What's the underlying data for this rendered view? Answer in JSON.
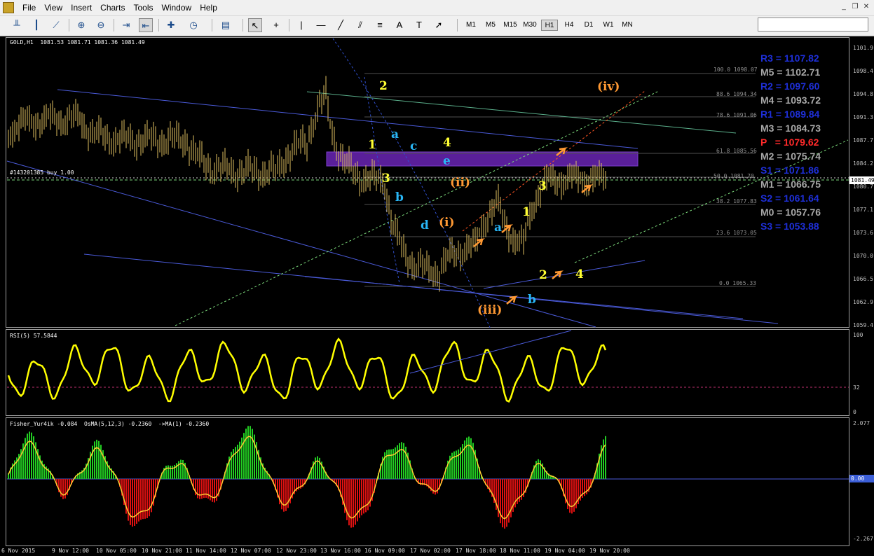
{
  "menu": {
    "items": [
      "File",
      "View",
      "Insert",
      "Charts",
      "Tools",
      "Window",
      "Help"
    ]
  },
  "toolbar": {
    "timeframes": [
      "M1",
      "M5",
      "M15",
      "M30",
      "H1",
      "H4",
      "D1",
      "W1",
      "MN"
    ],
    "active_timeframe": "H1"
  },
  "chart": {
    "title": "GOLD,H1  1081.53 1081.71 1081.36 1081.49",
    "order_label": "#143201385 buy 1.00",
    "current_price": "1081.49",
    "price_scale": [
      "1101.9",
      "1098.4",
      "1094.8",
      "1091.3",
      "1087.7",
      "1084.2",
      "1080.7",
      "1077.1",
      "1073.6",
      "1070.0",
      "1066.5",
      "1062.9",
      "1059.4"
    ],
    "pivots": [
      {
        "label": "R3 = 1107.82",
        "color": "#1e2fd8"
      },
      {
        "label": "M5 = 1102.71",
        "color": "#a8a8a8"
      },
      {
        "label": "R2 = 1097.60",
        "color": "#1e2fd8"
      },
      {
        "label": "M4 = 1093.72",
        "color": "#a8a8a8"
      },
      {
        "label": "R1 = 1089.84",
        "color": "#1e2fd8"
      },
      {
        "label": "M3 = 1084.73",
        "color": "#a8a8a8"
      },
      {
        "label": "P   = 1079.62",
        "color": "#ff2a2a"
      },
      {
        "label": "M2 = 1075.74",
        "color": "#a8a8a8"
      },
      {
        "label": "S1 = 1071.86",
        "color": "#1e2fd8"
      },
      {
        "label": "M1 = 1066.75",
        "color": "#a8a8a8"
      },
      {
        "label": "S2 = 1061.64",
        "color": "#1e2fd8"
      },
      {
        "label": "M0 = 1057.76",
        "color": "#a8a8a8"
      },
      {
        "label": "S3 = 1053.88",
        "color": "#1e2fd8"
      }
    ],
    "fib_levels": [
      "100.0 1098.07",
      "88.6 1094.34",
      "78.6 1091.06",
      "61.8 1085.56",
      "50.0 1081.70",
      "38.2 1077.83",
      "23.6 1073.05",
      "0.0 1065.33"
    ],
    "wave_labels_yellow": [
      "2",
      "1",
      "3",
      "4",
      "1",
      "3",
      "2",
      "4"
    ],
    "wave_labels_cyan": [
      "a",
      "c",
      "e",
      "b",
      "d",
      "a",
      "b"
    ],
    "wave_labels_orange": [
      "(iv)",
      "(ii)",
      "(i)",
      "(iii)"
    ]
  },
  "rsi": {
    "title": "RSI(5) 57.5844",
    "scale": [
      "100",
      "32",
      "0"
    ]
  },
  "fisher": {
    "title": "Fisher_Yur4ik -0.084  OsMA(5,12,3) -0.2360  ->MA(1) -0.2360",
    "scale": [
      "2.077",
      "0.00",
      "-2.267"
    ]
  },
  "time_axis": [
    "6 Nov 2015",
    "9 Nov 12:00",
    "10 Nov 05:00",
    "10 Nov 21:00",
    "11 Nov 14:00",
    "12 Nov 07:00",
    "12 Nov 23:00",
    "13 Nov 16:00",
    "16 Nov 09:00",
    "17 Nov 02:00",
    "17 Nov 18:00",
    "18 Nov 11:00",
    "19 Nov 04:00",
    "19 Nov 20:00"
  ],
  "colors": {
    "accent_yellow": "#ffff33",
    "cyan": "#29b6f6",
    "orange": "#ff9933",
    "purple_zone": "#5a1f9a"
  }
}
